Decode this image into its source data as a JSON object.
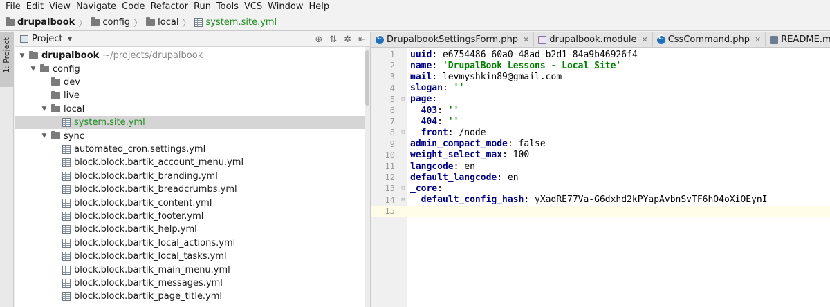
{
  "menu": [
    {
      "mnemonic": "F",
      "rest": "ile"
    },
    {
      "mnemonic": "E",
      "rest": "dit"
    },
    {
      "mnemonic": "V",
      "rest": "iew"
    },
    {
      "mnemonic": "N",
      "rest": "avigate"
    },
    {
      "mnemonic": "C",
      "rest": "ode"
    },
    {
      "mnemonic": "R",
      "rest": "efactor"
    },
    {
      "mnemonic": "R",
      "rest": "un"
    },
    {
      "mnemonic": "T",
      "rest": "ools"
    },
    {
      "mnemonic": "V",
      "rest": "CS"
    },
    {
      "mnemonic": "W",
      "rest": "indow"
    },
    {
      "mnemonic": "H",
      "rest": "elp"
    }
  ],
  "breadcrumb": [
    "drupalbook",
    "config",
    "local",
    "system.site.yml"
  ],
  "sidestrip": {
    "label": "1: Project"
  },
  "project_panel": {
    "title": "Project",
    "root_path": "~/projects/drupalbook"
  },
  "tree": [
    {
      "label": "drupalbook",
      "type": "folder",
      "level": 0,
      "expanded": true
    },
    {
      "label": "config",
      "type": "folder",
      "level": 1,
      "expanded": true
    },
    {
      "label": "dev",
      "type": "folder",
      "level": 2,
      "expanded": false
    },
    {
      "label": "live",
      "type": "folder",
      "level": 2,
      "expanded": false
    },
    {
      "label": "local",
      "type": "folder",
      "level": 2,
      "expanded": true
    },
    {
      "label": "system.site.yml",
      "type": "file",
      "level": 3,
      "selected": true
    },
    {
      "label": "sync",
      "type": "folder",
      "level": 2,
      "expanded": true
    },
    {
      "label": "automated_cron.settings.yml",
      "type": "file",
      "level": 3
    },
    {
      "label": "block.block.bartik_account_menu.yml",
      "type": "file",
      "level": 3
    },
    {
      "label": "block.block.bartik_branding.yml",
      "type": "file",
      "level": 3
    },
    {
      "label": "block.block.bartik_breadcrumbs.yml",
      "type": "file",
      "level": 3
    },
    {
      "label": "block.block.bartik_content.yml",
      "type": "file",
      "level": 3
    },
    {
      "label": "block.block.bartik_footer.yml",
      "type": "file",
      "level": 3
    },
    {
      "label": "block.block.bartik_help.yml",
      "type": "file",
      "level": 3
    },
    {
      "label": "block.block.bartik_local_actions.yml",
      "type": "file",
      "level": 3
    },
    {
      "label": "block.block.bartik_local_tasks.yml",
      "type": "file",
      "level": 3
    },
    {
      "label": "block.block.bartik_main_menu.yml",
      "type": "file",
      "level": 3
    },
    {
      "label": "block.block.bartik_messages.yml",
      "type": "file",
      "level": 3
    },
    {
      "label": "block.block.bartik_page_title.yml",
      "type": "file",
      "level": 3
    }
  ],
  "tabs": [
    {
      "label": "DrupalbookSettingsForm.php",
      "icon": "class-c-icon",
      "active": false
    },
    {
      "label": "drupalbook.module",
      "icon": "php-file-icon",
      "active": false
    },
    {
      "label": "CssCommand.php",
      "icon": "class-c-icon",
      "active": false
    },
    {
      "label": "README.md",
      "icon": "markdown-file-icon",
      "active": false
    }
  ],
  "code_lines": [
    {
      "num": "1",
      "key": "uuid",
      "value": "e6754486-60a0-48ad-b2d1-84a9b46926f4",
      "vtype": "plain",
      "indent": ""
    },
    {
      "num": "2",
      "key": "name",
      "value": "'DrupalBook Lessons - Local Site'",
      "vtype": "string",
      "indent": ""
    },
    {
      "num": "3",
      "key": "mail",
      "value": "levmyshkin89@gmail.com",
      "vtype": "plain",
      "indent": ""
    },
    {
      "num": "4",
      "key": "slogan",
      "value": "''",
      "vtype": "string",
      "indent": ""
    },
    {
      "num": "5",
      "key": "page",
      "value": "",
      "vtype": "plain",
      "indent": ""
    },
    {
      "num": "6",
      "key": "403",
      "value": "''",
      "vtype": "string",
      "indent": "  "
    },
    {
      "num": "7",
      "key": "404",
      "value": "''",
      "vtype": "string",
      "indent": "  "
    },
    {
      "num": "8",
      "key": "front",
      "value": "/node",
      "vtype": "plain",
      "indent": "  "
    },
    {
      "num": "9",
      "key": "admin_compact_mode",
      "value": "false",
      "vtype": "plain",
      "indent": ""
    },
    {
      "num": "10",
      "key": "weight_select_max",
      "value": "100",
      "vtype": "plain",
      "indent": ""
    },
    {
      "num": "11",
      "key": "langcode",
      "value": "en",
      "vtype": "plain",
      "indent": ""
    },
    {
      "num": "12",
      "key": "default_langcode",
      "value": "en",
      "vtype": "plain",
      "indent": ""
    },
    {
      "num": "13",
      "key": "_core",
      "value": "",
      "vtype": "plain",
      "indent": ""
    },
    {
      "num": "14",
      "key": "default_config_hash",
      "value": "yXadRE77Va-G6dxhd2kPYapAvbnSvTF6hO4oXiOEynI",
      "vtype": "plain",
      "indent": "  "
    },
    {
      "num": "15",
      "key": "",
      "value": "",
      "vtype": "plain",
      "indent": "",
      "current": true
    }
  ]
}
